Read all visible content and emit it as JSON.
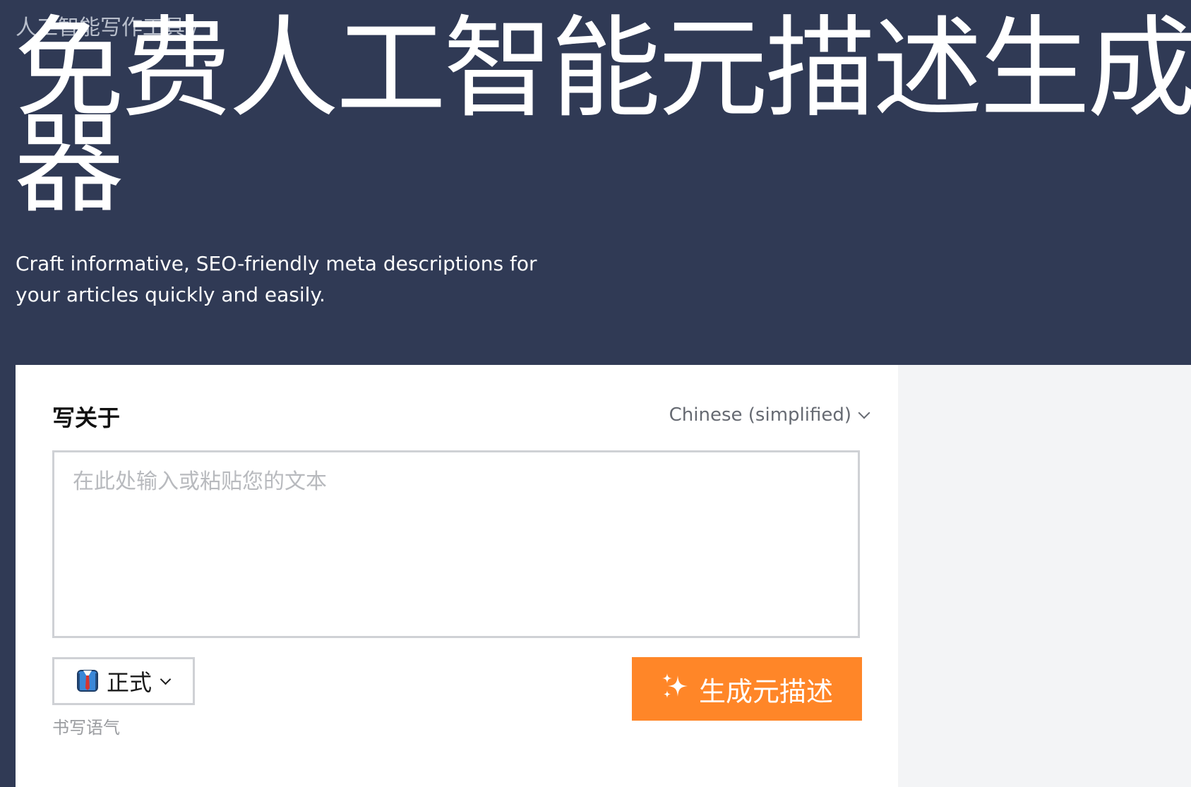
{
  "breadcrumb": {
    "parent": "人工智能写作工具",
    "separator": "/"
  },
  "header": {
    "title": "免费人工智能元描述生成器",
    "subtitle": "Craft informative, SEO-friendly meta descriptions for your articles quickly and easily."
  },
  "form": {
    "write_about_label": "写关于",
    "language": "Chinese (simplified)",
    "input_placeholder": "在此处输入或粘贴您的文本",
    "input_value": "",
    "tone": {
      "selected": "正式",
      "icon": "formal-suit-icon",
      "caption": "书写语气"
    },
    "generate_button": {
      "label": "生成元描述",
      "icon": "sparkle-icon"
    }
  },
  "colors": {
    "header_bg": "#303a55",
    "accent": "#ff8628",
    "side_panel_bg": "#f3f4f6"
  }
}
